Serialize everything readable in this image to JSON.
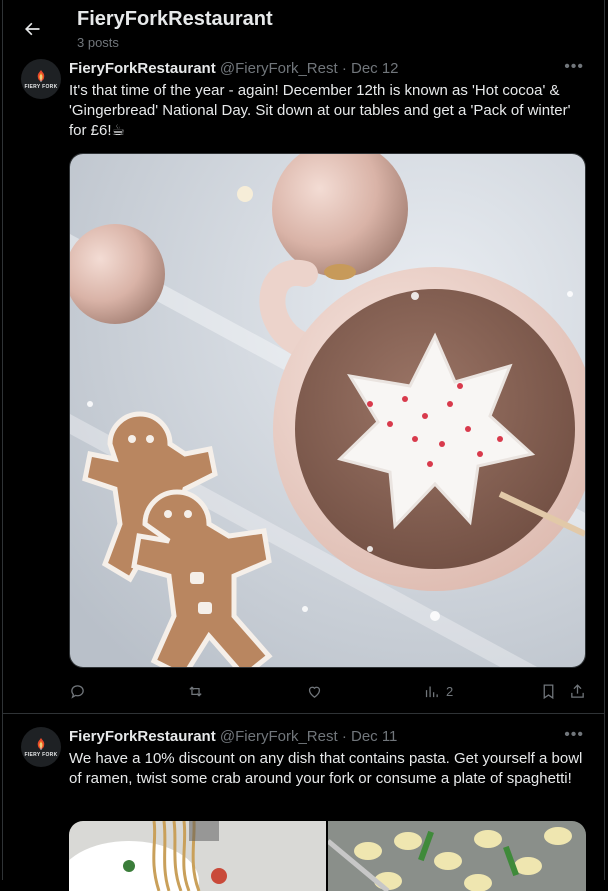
{
  "header": {
    "title": "FieryForkRestaurant",
    "subtitle": "3 posts"
  },
  "posts": [
    {
      "name": "FieryForkRestaurant",
      "handle": "@FieryFork_Rest",
      "separator": "·",
      "date": "Dec 12",
      "text": "It's that time of the year - again! December 12th is known as 'Hot cocoa' & 'Gingerbread' National Day. Sit down at our tables and get a 'Pack of winter' for £6!☕",
      "views": "2",
      "media_alt": "hot-cocoa-gingerbread-photo"
    },
    {
      "name": "FieryForkRestaurant",
      "handle": "@FieryFork_Rest",
      "separator": "·",
      "date": "Dec 11",
      "text": "We have a 10% discount on any dish that contains pasta. Get yourself a bowl of ramen, twist some crab around your fork or consume a plate of spaghetti!",
      "media_alt": "pasta-photos"
    }
  ],
  "avatar_text": "FIERY FORK",
  "more_label": "•••",
  "icons": [
    "back-arrow-icon",
    "reply-icon",
    "repost-icon",
    "like-icon",
    "views-icon",
    "bookmark-icon",
    "share-icon"
  ],
  "colors": {
    "background": "#000000",
    "text": "#e7e9ea",
    "muted": "#71767b",
    "border": "#2f3336"
  }
}
